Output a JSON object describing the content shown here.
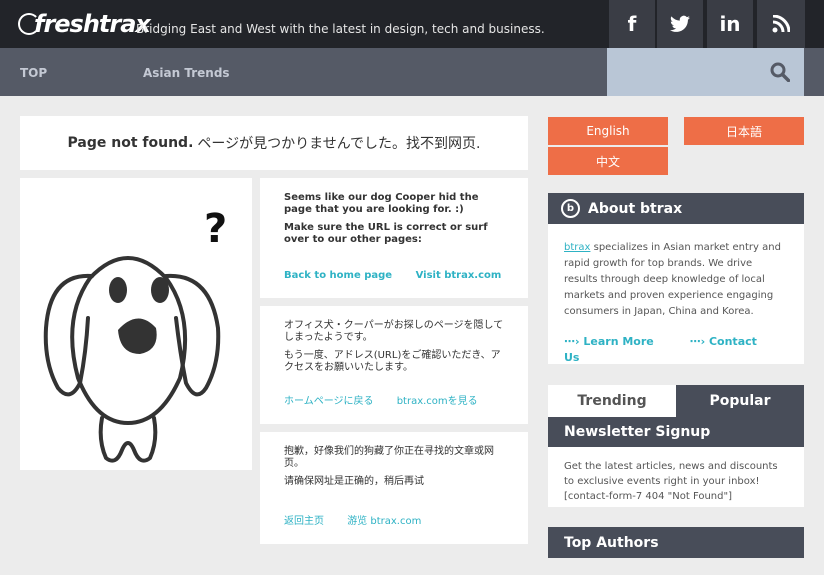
{
  "header": {
    "logo_text": "freshtrax",
    "tagline": "Bridging East and West with the latest in design, tech and business.",
    "social": [
      {
        "icon": "facebook-icon",
        "glyph": "f"
      },
      {
        "icon": "twitter-icon",
        "glyph": "t"
      },
      {
        "icon": "linkedin-icon",
        "glyph": "in"
      },
      {
        "icon": "rss-icon",
        "glyph": "rss"
      }
    ]
  },
  "nav": {
    "items": [
      "TOP",
      "Asian Trends"
    ]
  },
  "notfound": {
    "bold": "Page not found.",
    "rest": "ページが見つかりませんでした。找不到网页."
  },
  "messages": {
    "en": {
      "line1": "Seems like our dog Cooper hid the page that you are looking for. :)",
      "line2": "Make sure the URL is correct or surf over to our other pages:",
      "link_home": "Back to home page",
      "link_site": "Visit btrax.com"
    },
    "ja": {
      "line1": "オフィス犬・クーパーがお探しのページを隠してしまったようです。",
      "line2": "もう一度、アドレス(URL)をご確認いただき、アクセスをお願いいたします。",
      "link_home": "ホームページに戻る",
      "link_site": "btrax.comを見る"
    },
    "zh": {
      "line1": "抱歉，好像我们的狗藏了你正在寻找的文章或网页。",
      "line2": "请确保网址是正确的，稍后再试",
      "link_home": "返回主页",
      "link_site": "游览 btrax.com"
    }
  },
  "languages": {
    "english": "English",
    "japanese": "日本語",
    "chinese": "中文"
  },
  "about": {
    "title": "About btrax",
    "brand": "btrax",
    "text": " specializes in Asian market entry and rapid growth for top brands. We drive results through deep knowledge of local markets and proven experience engaging consumers in Japan, China and Korea.",
    "learn_more": "Learn More",
    "contact": "Contact Us"
  },
  "tabs": {
    "trending": "Trending",
    "popular": "Popular"
  },
  "newsletter": {
    "title": "Newsletter Signup",
    "text": "Get the latest articles, news and discounts to exclusive events right in your inbox!",
    "error": "[contact-form-7 404 \"Not Found\"]"
  },
  "authors": {
    "title": "Top Authors"
  },
  "colors": {
    "accent": "#ee6e47",
    "link": "#2eb2c4",
    "dark": "#222429",
    "nav": "#555a66"
  }
}
